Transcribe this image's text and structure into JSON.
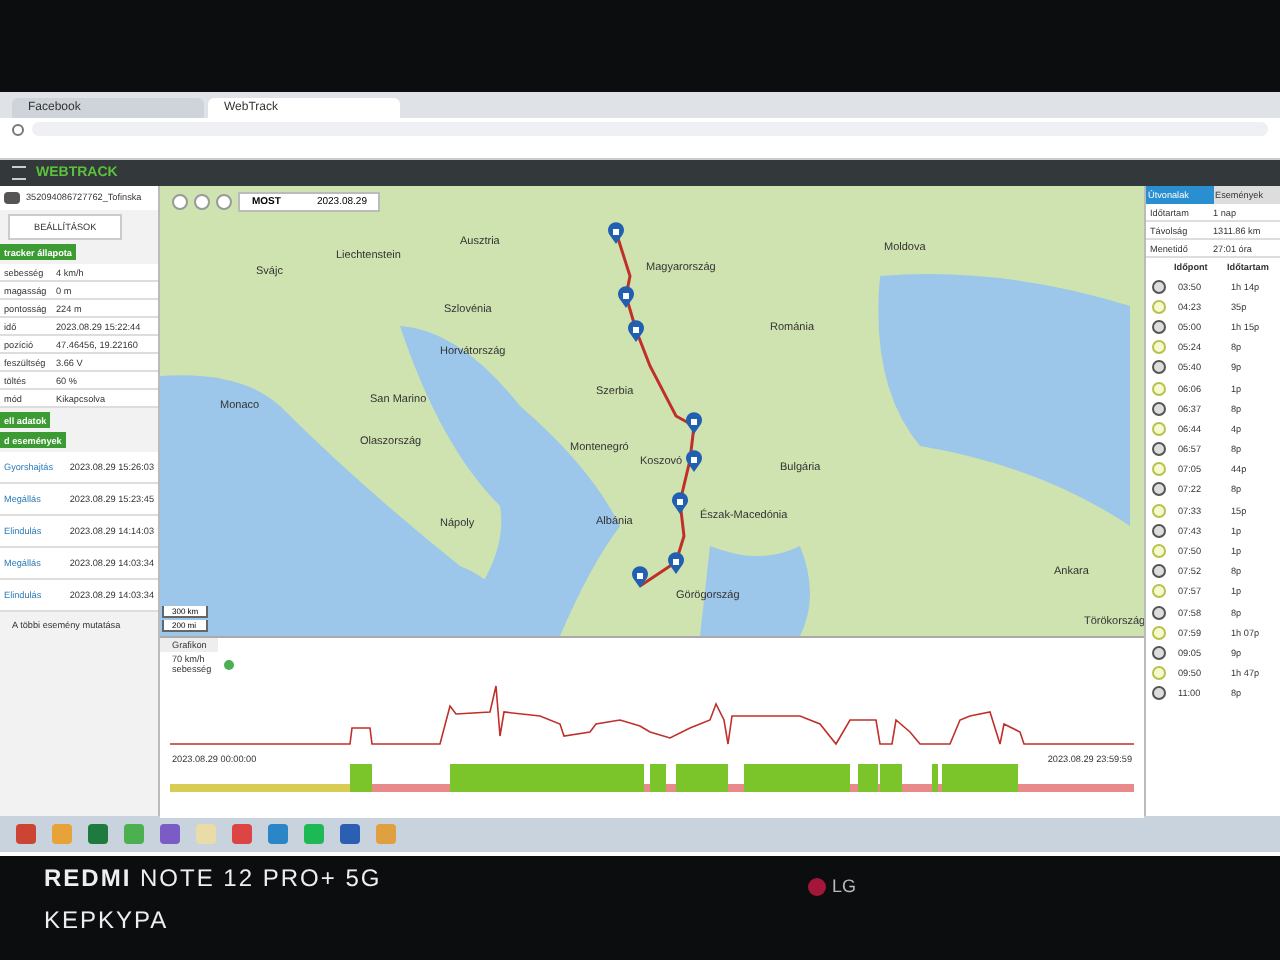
{
  "browser": {
    "tabs": [
      {
        "title": "Facebook",
        "selected": false
      },
      {
        "title": "WebTrack",
        "selected": true
      }
    ]
  },
  "app": {
    "logo": "WEBTRACK"
  },
  "left_panel": {
    "device": "352094086727762_Tofinska",
    "settings_button": "BEÁLLÍTÁSOK",
    "status_title": "tracker állapota",
    "status_rows": [
      {
        "label": "sebesség",
        "value": "4 km/h"
      },
      {
        "label": "magasság",
        "value": "0 m"
      },
      {
        "label": "pontosság",
        "value": "224 m"
      },
      {
        "label": "idő",
        "value": "2023.08.29 15:22:44"
      },
      {
        "label": "pozíció",
        "value": "47.46456, 19.22160"
      },
      {
        "label": "feszültség",
        "value": "3.66 V"
      },
      {
        "label": "töltés",
        "value": "60 %"
      },
      {
        "label": "mód",
        "value": "Kikapcsolva"
      }
    ],
    "data_section": "ell adatok",
    "events_title": "d események",
    "events": [
      {
        "name": "Gyorshajtás",
        "time": "2023.08.29 15:26:03"
      },
      {
        "name": "Megállás",
        "time": "2023.08.29 15:23:45"
      },
      {
        "name": "Elindulás",
        "time": "2023.08.29 14:14:03"
      },
      {
        "name": "Megállás",
        "time": "2023.08.29 14:03:34"
      },
      {
        "name": "Elindulás",
        "time": "2023.08.29 14:03:34"
      }
    ],
    "more_events": "A többi esemény mutatása"
  },
  "map": {
    "mode": "MOST",
    "date": "2023.08.29",
    "labels": [
      "Ausztria",
      "Liechtenstein",
      "Svájc",
      "Magyarország",
      "Szlovénia",
      "Horvátország",
      "Románia",
      "Moldova",
      "Monaco",
      "San Marino",
      "Olaszország",
      "Szerbia",
      "Montenegró",
      "Koszovó",
      "Bulgária",
      "Albánia",
      "Észak-Macedónia",
      "Nápoly",
      "Görögország",
      "Ankara",
      "Törökország"
    ],
    "scale": [
      "300 km",
      "200 mi"
    ]
  },
  "chart": {
    "title": "Grafikon",
    "legend": [
      "70 km/h",
      "sebesség"
    ],
    "start": "2023.08.29 00:00:00",
    "end": "2023.08.29 23:59:59"
  },
  "right_panel": {
    "tabs": [
      {
        "label": "Útvonalak",
        "selected": true
      },
      {
        "label": "Események",
        "selected": false
      }
    ],
    "info": [
      {
        "label": "Időtartam",
        "value": "1 nap"
      },
      {
        "label": "Távolság",
        "value": "1311.86 km"
      },
      {
        "label": "Menetidő",
        "value": "27:01 óra"
      }
    ],
    "columns": [
      "Időpont",
      "Időtartam"
    ],
    "timeline": [
      {
        "kind": "stop",
        "time": "03:50",
        "duration": "1h 14p"
      },
      {
        "kind": "move",
        "time": "04:23",
        "duration": "35p"
      },
      {
        "kind": "stop",
        "time": "05:00",
        "duration": "1h 15p"
      },
      {
        "kind": "move",
        "time": "05:24",
        "duration": "8p"
      },
      {
        "kind": "stop",
        "time": "05:40",
        "duration": "9p"
      },
      {
        "kind": "move",
        "time": "06:06",
        "duration": "1p"
      },
      {
        "kind": "stop",
        "time": "06:37",
        "duration": "8p"
      },
      {
        "kind": "move",
        "time": "06:44",
        "duration": "4p"
      },
      {
        "kind": "stop",
        "time": "06:57",
        "duration": "8p"
      },
      {
        "kind": "move",
        "time": "07:05",
        "duration": "44p"
      },
      {
        "kind": "stop",
        "time": "07:22",
        "duration": "8p"
      },
      {
        "kind": "move",
        "time": "07:33",
        "duration": "15p"
      },
      {
        "kind": "stop",
        "time": "07:43",
        "duration": "1p"
      },
      {
        "kind": "move",
        "time": "07:50",
        "duration": "1p"
      },
      {
        "kind": "stop",
        "time": "07:52",
        "duration": "8p"
      },
      {
        "kind": "move",
        "time": "07:57",
        "duration": "1p"
      },
      {
        "kind": "stop",
        "time": "07:58",
        "duration": "8p"
      },
      {
        "kind": "move",
        "time": "07:59",
        "duration": "1h 07p"
      },
      {
        "kind": "stop",
        "time": "09:05",
        "duration": "9p"
      },
      {
        "kind": "move",
        "time": "09:50",
        "duration": "1h 47p"
      },
      {
        "kind": "stop",
        "time": "11:00",
        "duration": "8p"
      }
    ]
  },
  "footer": {
    "watermark": "**REDMI** NOTE 12 PRO+ 5G",
    "caption": "KEPKYPA",
    "brand": "LG"
  }
}
